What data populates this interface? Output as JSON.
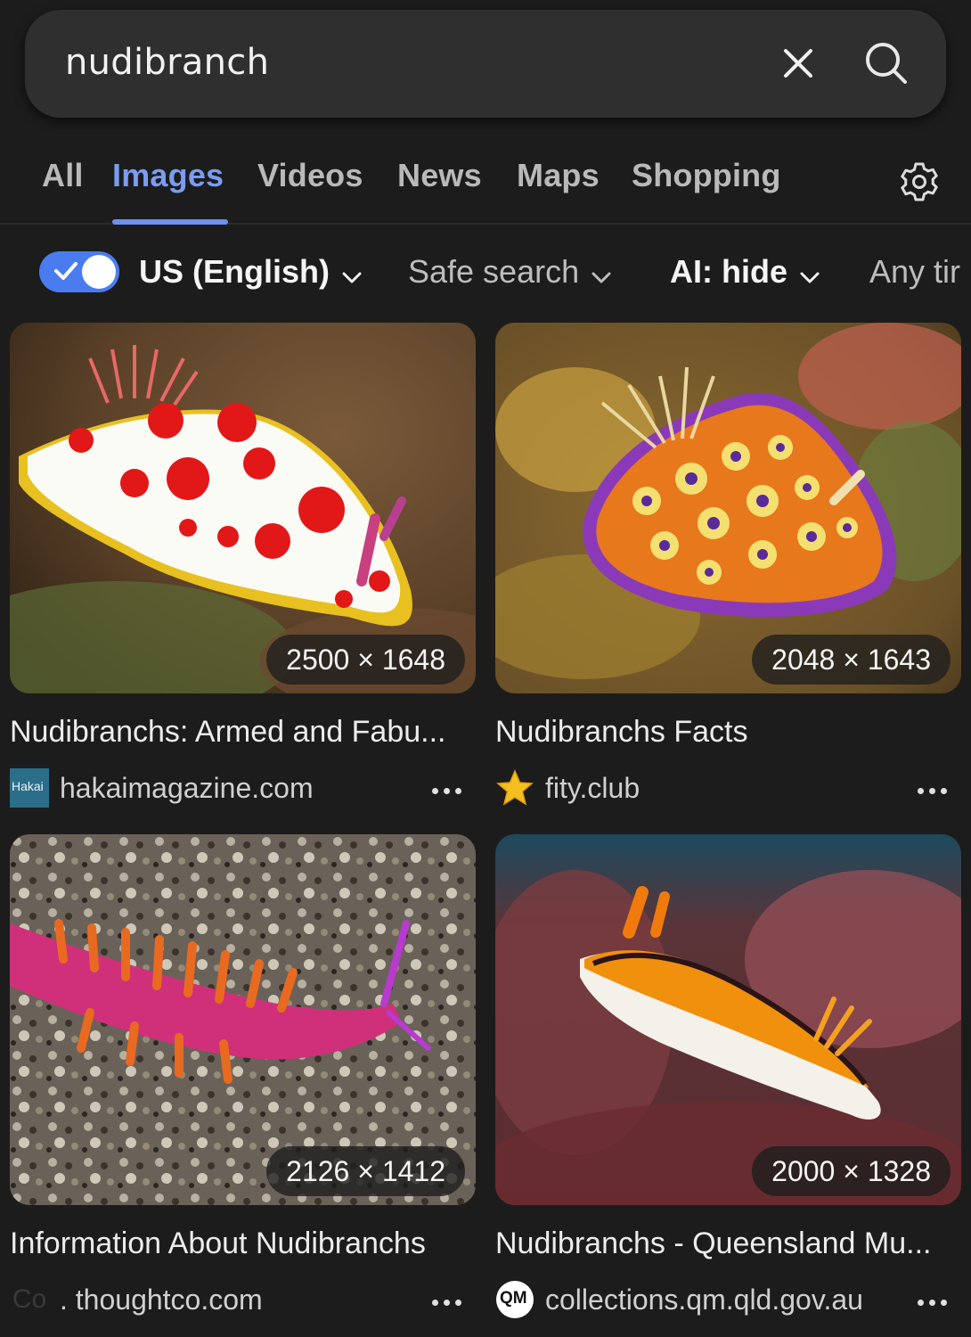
{
  "search": {
    "query": "nudibranch"
  },
  "tabs": [
    {
      "label": "All"
    },
    {
      "label": "Images"
    },
    {
      "label": "Videos"
    },
    {
      "label": "News"
    },
    {
      "label": "Maps"
    },
    {
      "label": "Shopping"
    }
  ],
  "active_tab": "Images",
  "filters": {
    "region_toggle_on": true,
    "region": "US (English)",
    "safe_search": "Safe search",
    "ai": "AI: hide",
    "time": "Any tir"
  },
  "results": [
    {
      "dims": "2500 × 1648",
      "title": "Nudibranchs: Armed and Fabu...",
      "domain": "hakaimagazine.com",
      "favicon": "hakai-logo",
      "favicon_text": "Hakai"
    },
    {
      "dims": "2048 × 1643",
      "title": "Nudibranchs Facts",
      "domain": "fity.club",
      "favicon": "star-icon"
    },
    {
      "dims": "2126 × 1412",
      "title": "Information About Nudibranchs",
      "domain": ". thoughtco.com",
      "favicon": "thoughtco-logo",
      "favicon_text": "Co"
    },
    {
      "dims": "2000 × 1328",
      "title": "Nudibranchs - Queensland Mu...",
      "domain": "collections.qm.qld.gov.au",
      "favicon": "qm-logo",
      "favicon_text": "QM"
    }
  ],
  "colors": {
    "accent": "#6e8ff0",
    "background": "#1c1c1c",
    "searchbar": "#2f2f2f"
  }
}
